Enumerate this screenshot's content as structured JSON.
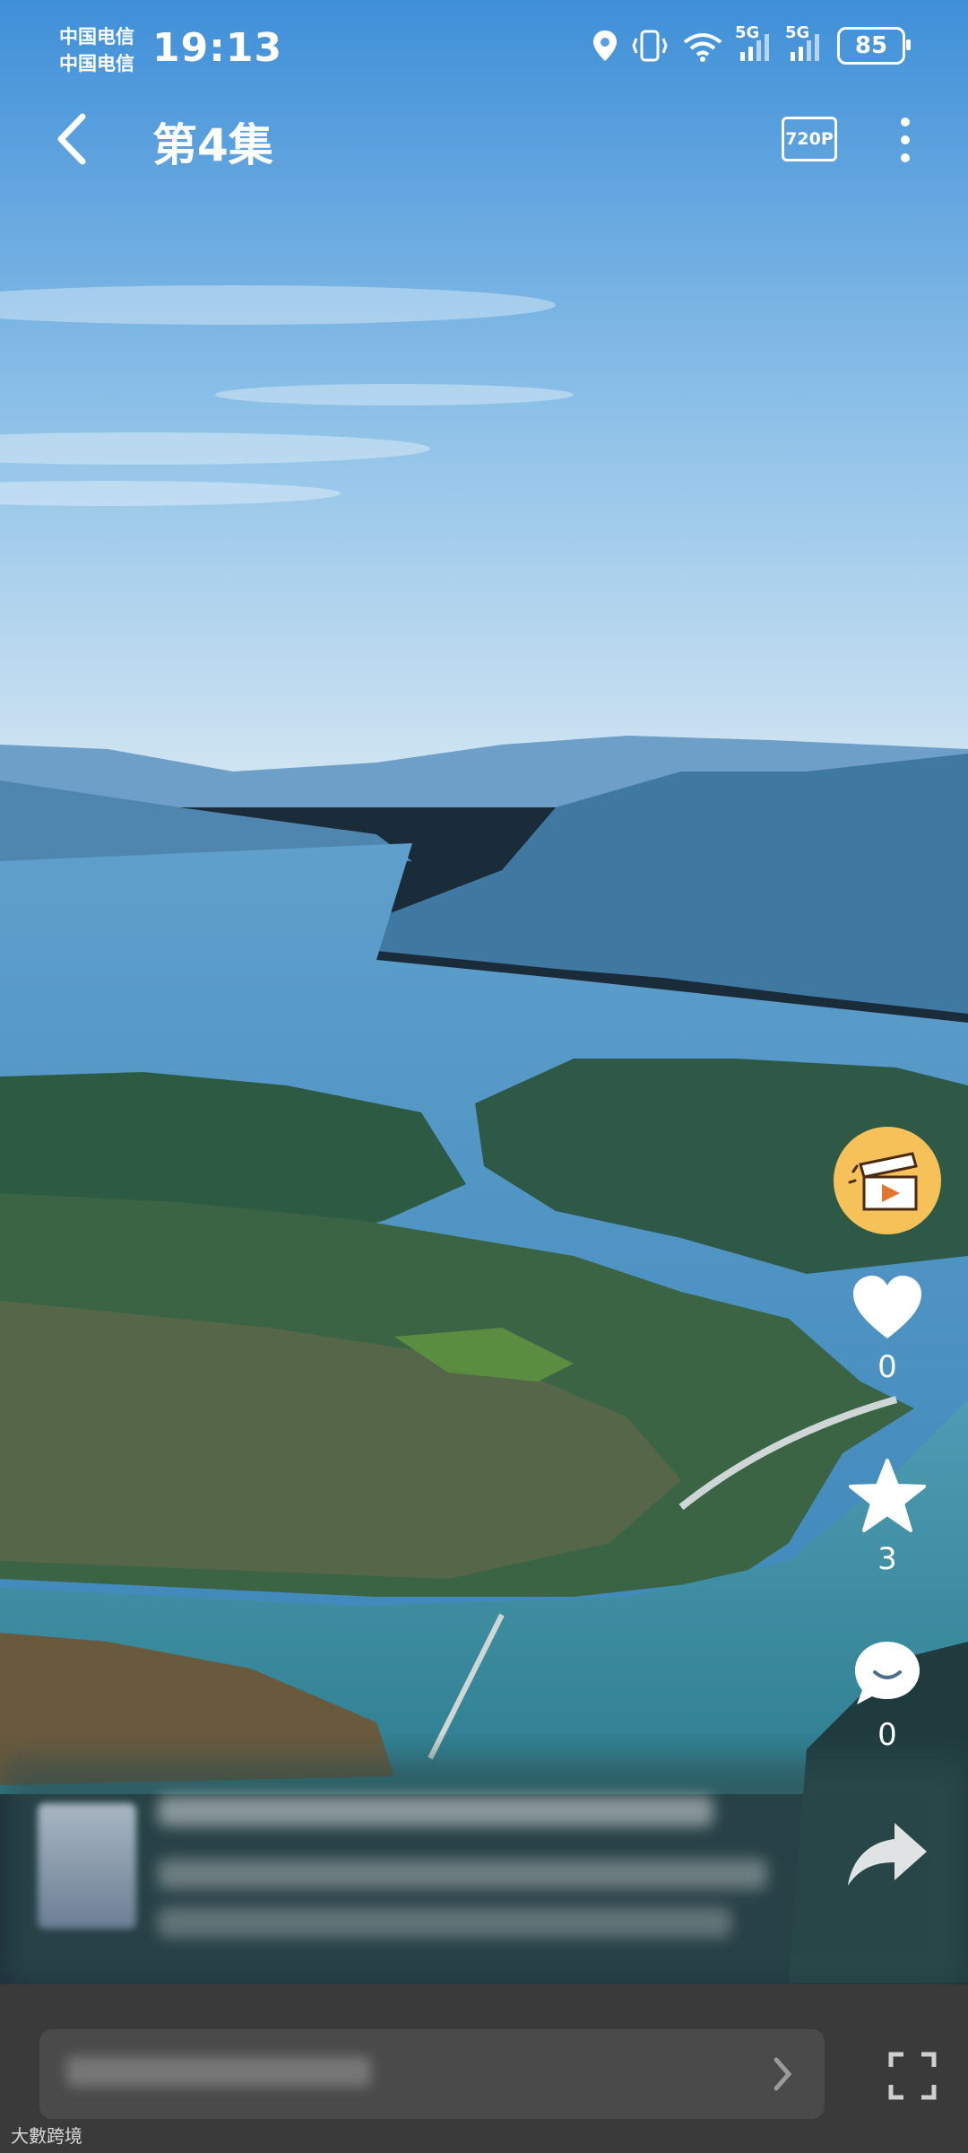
{
  "status": {
    "carrier_1": "中国电信",
    "carrier_2": "中国电信",
    "time": "19:13",
    "battery": "85",
    "signal_label": "5G"
  },
  "header": {
    "title": "第4集",
    "quality": "720P"
  },
  "actions": {
    "like_count": "0",
    "favorite_count": "3",
    "comment_count": "0"
  },
  "watermark": "大數跨境",
  "colors": {
    "accent": "#f7c15a",
    "bar": "#3a3a3a"
  }
}
